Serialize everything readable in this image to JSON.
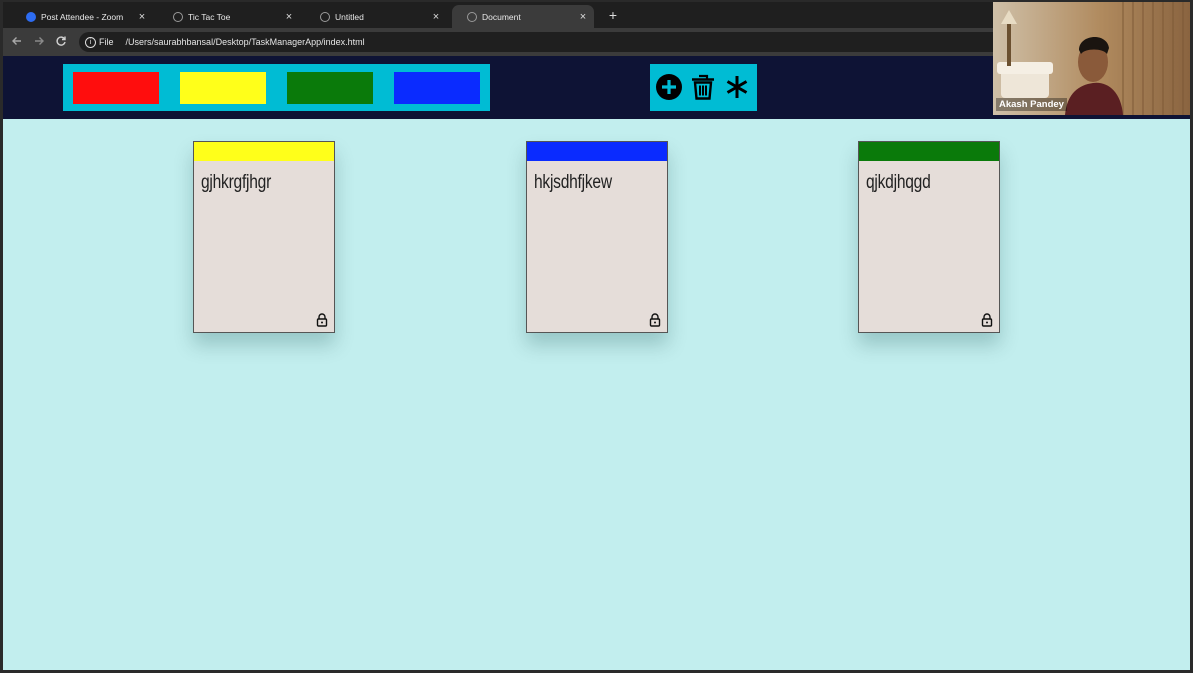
{
  "browser": {
    "tabs": [
      {
        "title": "Post Attendee - Zoom",
        "icon": "zoom-icon",
        "active": false
      },
      {
        "title": "Tic Tac Toe",
        "icon": "globe-icon",
        "active": false
      },
      {
        "title": "Untitled",
        "icon": "globe-icon",
        "active": false
      },
      {
        "title": "Document",
        "icon": "globe-icon",
        "active": true
      }
    ],
    "close_glyph": "×",
    "new_tab_glyph": "+",
    "scheme_label": "File",
    "url": "/Users/saurabhbansal/Desktop/TaskManagerApp/index.html"
  },
  "toolbar": {
    "colors": [
      {
        "name": "red",
        "hex": "#ff0d0d"
      },
      {
        "name": "yellow",
        "hex": "#ffff1a"
      },
      {
        "name": "green",
        "hex": "#0a7a0a"
      },
      {
        "name": "blue",
        "hex": "#0a2bff"
      }
    ],
    "actions": [
      {
        "name": "add-icon"
      },
      {
        "name": "trash-icon"
      },
      {
        "name": "asterisk-icon"
      }
    ],
    "panel_color": "#00bcd4",
    "bar_color": "#0e1335"
  },
  "tickets": [
    {
      "color": "#ffff1a",
      "text": "gjhkrgfjhgr",
      "locked": true
    },
    {
      "color": "#0a2bff",
      "text": "hkjsdhfjkew",
      "locked": true
    },
    {
      "color": "#0a7a0a",
      "text": "qjkdjhqgd",
      "locked": true
    }
  ],
  "video": {
    "participant_name": "Akash Pandey"
  }
}
